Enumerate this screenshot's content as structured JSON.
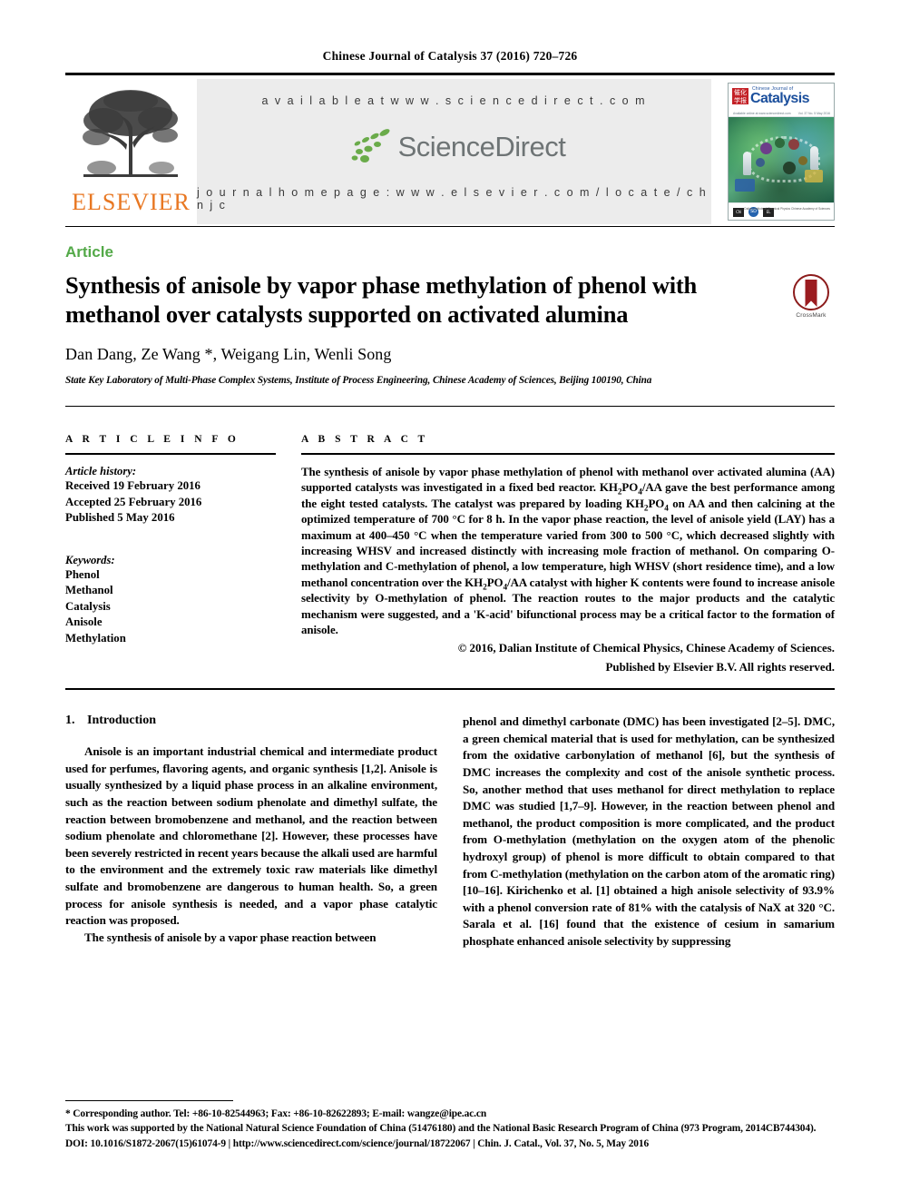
{
  "running_head": "Chinese Journal of Catalysis 37 (2016) 720–726",
  "masthead": {
    "available_at": "a v a i l a b l e   a t   w w w . s c i e n c e d i r e c t . c o m",
    "sciencedirect_word": "ScienceDirect",
    "journal_homepage": "j o u r n a l   h o m e p a g e :   w w w . e l s e v i e r . c o m / l o c a t e / c h n j c",
    "publisher_logo_text": "ELSEVIER",
    "cover": {
      "series_line": "Chinese Journal of",
      "title": "Catalysis",
      "chinese_badge": "催化学报",
      "left_meta": "Available online at www.sciencedirect.com",
      "right_meta": "Vol. 37 No. 5 May 2016",
      "credit": "Dalian Institute of Chemical Physics\nChinese Academy of Sciences"
    }
  },
  "article": {
    "type": "Article",
    "title": "Synthesis of anisole by vapor phase methylation of phenol with methanol over catalysts supported on activated alumina",
    "crossmark_label": "CrossMark",
    "authors": "Dan Dang, Ze Wang *, Weigang Lin, Wenli Song",
    "affiliation": "State Key Laboratory of Multi-Phase Complex Systems, Institute of Process Engineering, Chinese Academy of Sciences, Beijing 100190, China"
  },
  "article_info": {
    "heading": "A R T I C L E   I N F O",
    "history_label": "Article history:",
    "history": [
      "Received 19 February 2016",
      "Accepted 25 February 2016",
      "Published 5 May 2016"
    ],
    "keywords_label": "Keywords:",
    "keywords": [
      "Phenol",
      "Methanol",
      "Catalysis",
      "Anisole",
      "Methylation"
    ]
  },
  "abstract": {
    "heading": "A B S T R A C T",
    "text": "The synthesis of anisole by vapor phase methylation of phenol with methanol over activated alumina (AA) supported catalysts was investigated in a fixed bed reactor. KH2PO4/AA gave the best performance among the eight tested catalysts. The catalyst was prepared by loading KH2PO4 on AA and then calcining at the optimized temperature of 700 °C for 8 h. In the vapor phase reaction, the level of anisole yield (LAY) has a maximum at 400–450 °C when the temperature varied from 300 to 500 °C, which decreased slightly with increasing WHSV and increased distinctly with increasing mole fraction of methanol. On comparing O-methylation and C-methylation of phenol, a low temperature, high WHSV (short residence time), and a low methanol concentration over the KH2PO4/AA catalyst with higher K contents were found to increase anisole selectivity by O-methylation of phenol. The reaction routes to the major products and the catalytic mechanism were suggested, and a 'K-acid' bifunctional process may be a critical factor to the formation of anisole.",
    "copyright_line1": "© 2016, Dalian Institute of Chemical Physics, Chinese Academy of Sciences.",
    "copyright_line2": "Published by Elsevier B.V. All rights reserved."
  },
  "body": {
    "section_number": "1.",
    "section_title": "Introduction",
    "left_paragraphs": [
      "Anisole is an important industrial chemical and intermediate product used for perfumes, flavoring agents, and organic synthesis [1,2]. Anisole is usually synthesized by a liquid phase process in an alkaline environment, such as the reaction between sodium phenolate and dimethyl sulfate, the reaction between bromobenzene and methanol, and the reaction between sodium phenolate and chloromethane [2]. However, these processes have been severely restricted in recent years because the alkali used are harmful to the environment and the extremely toxic raw materials like dimethyl sulfate and bromobenzene are dangerous to human health. So, a green process for anisole synthesis is needed, and a vapor phase catalytic reaction was proposed.",
      "The synthesis of anisole by a vapor phase reaction between"
    ],
    "right_paragraphs": [
      "phenol and dimethyl carbonate (DMC) has been investigated [2–5]. DMC, a green chemical material that is used for methylation, can be synthesized from the oxidative carbonylation of methanol [6], but the synthesis of DMC increases the complexity and cost of the anisole synthetic process. So, another method that uses methanol for direct methylation to replace DMC was studied [1,7–9]. However, in the reaction between phenol and methanol, the product composition is more complicated, and the product from O-methylation (methylation on the oxygen atom of the phenolic hydroxyl group) of phenol is more difficult to obtain compared to that from C-methylation (methylation on the carbon atom of the aromatic ring) [10–16]. Kirichenko et al. [1] obtained a high anisole selectivity of 93.9% with a phenol conversion rate of 81% with the catalysis of NaX at 320 °C. Sarala et al. [16] found that the existence of cesium in samarium phosphate enhanced anisole selectivity by suppressing"
    ]
  },
  "footnotes": {
    "corresponding": "* Corresponding author. Tel: +86-10-82544963; Fax: +86-10-82622893; E-mail: wangze@ipe.ac.cn",
    "funding": "This work was supported by the National Natural Science Foundation of China (51476180) and the National Basic Research Program of China (973 Program, 2014CB744304).",
    "doi": "DOI: 10.1016/S1872-2067(15)61074-9 | http://www.sciencedirect.com/science/journal/18722067 | Chin. J. Catal., Vol. 37, No. 5, May 2016"
  },
  "colors": {
    "article_green": "#53a948",
    "elsevier_orange": "#e87722",
    "sciencedirect_gray": "#6e7475",
    "crossmark_red": "#9b1c20",
    "band_gray": "#ececec"
  }
}
